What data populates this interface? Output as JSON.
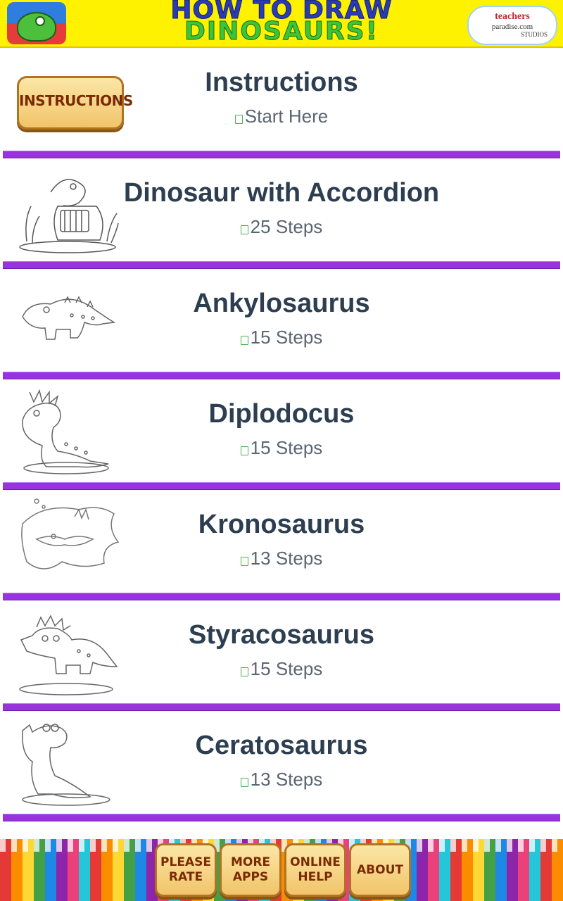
{
  "header": {
    "banner_line1": "HOW TO DRAW",
    "banner_line2": "DINOSAURS!",
    "logo_line1": "teachers",
    "logo_line2": "paradise.com",
    "logo_line3": "STUDIOS"
  },
  "instructions_row": {
    "button_label": "INSTRUCTIONS",
    "title": "Instructions",
    "subtitle": "Start Here"
  },
  "lessons": [
    {
      "title": "Dinosaur with Accordion",
      "steps": "25 Steps",
      "icon": "dino-accordion-icon"
    },
    {
      "title": "Ankylosaurus",
      "steps": "15 Steps",
      "icon": "ankylosaurus-icon"
    },
    {
      "title": "Diplodocus",
      "steps": "15 Steps",
      "icon": "diplodocus-icon"
    },
    {
      "title": "Kronosaurus",
      "steps": "13 Steps",
      "icon": "kronosaurus-icon"
    },
    {
      "title": "Styracosaurus",
      "steps": "15 Steps",
      "icon": "styracosaurus-icon"
    },
    {
      "title": "Ceratosaurus",
      "steps": "13 Steps",
      "icon": "ceratosaurus-icon"
    }
  ],
  "footer": {
    "rate_line1": "PLEASE",
    "rate_line2": "RATE",
    "more_line1": "MORE",
    "more_line2": "APPS",
    "help_line1": "ONLINE",
    "help_line2": "HELP",
    "about": "ABOUT"
  },
  "colors": {
    "banner_bg": "#fff200",
    "divider": "#9933dd",
    "title_text": "#2c3e50",
    "subtitle_text": "#5a6570"
  }
}
